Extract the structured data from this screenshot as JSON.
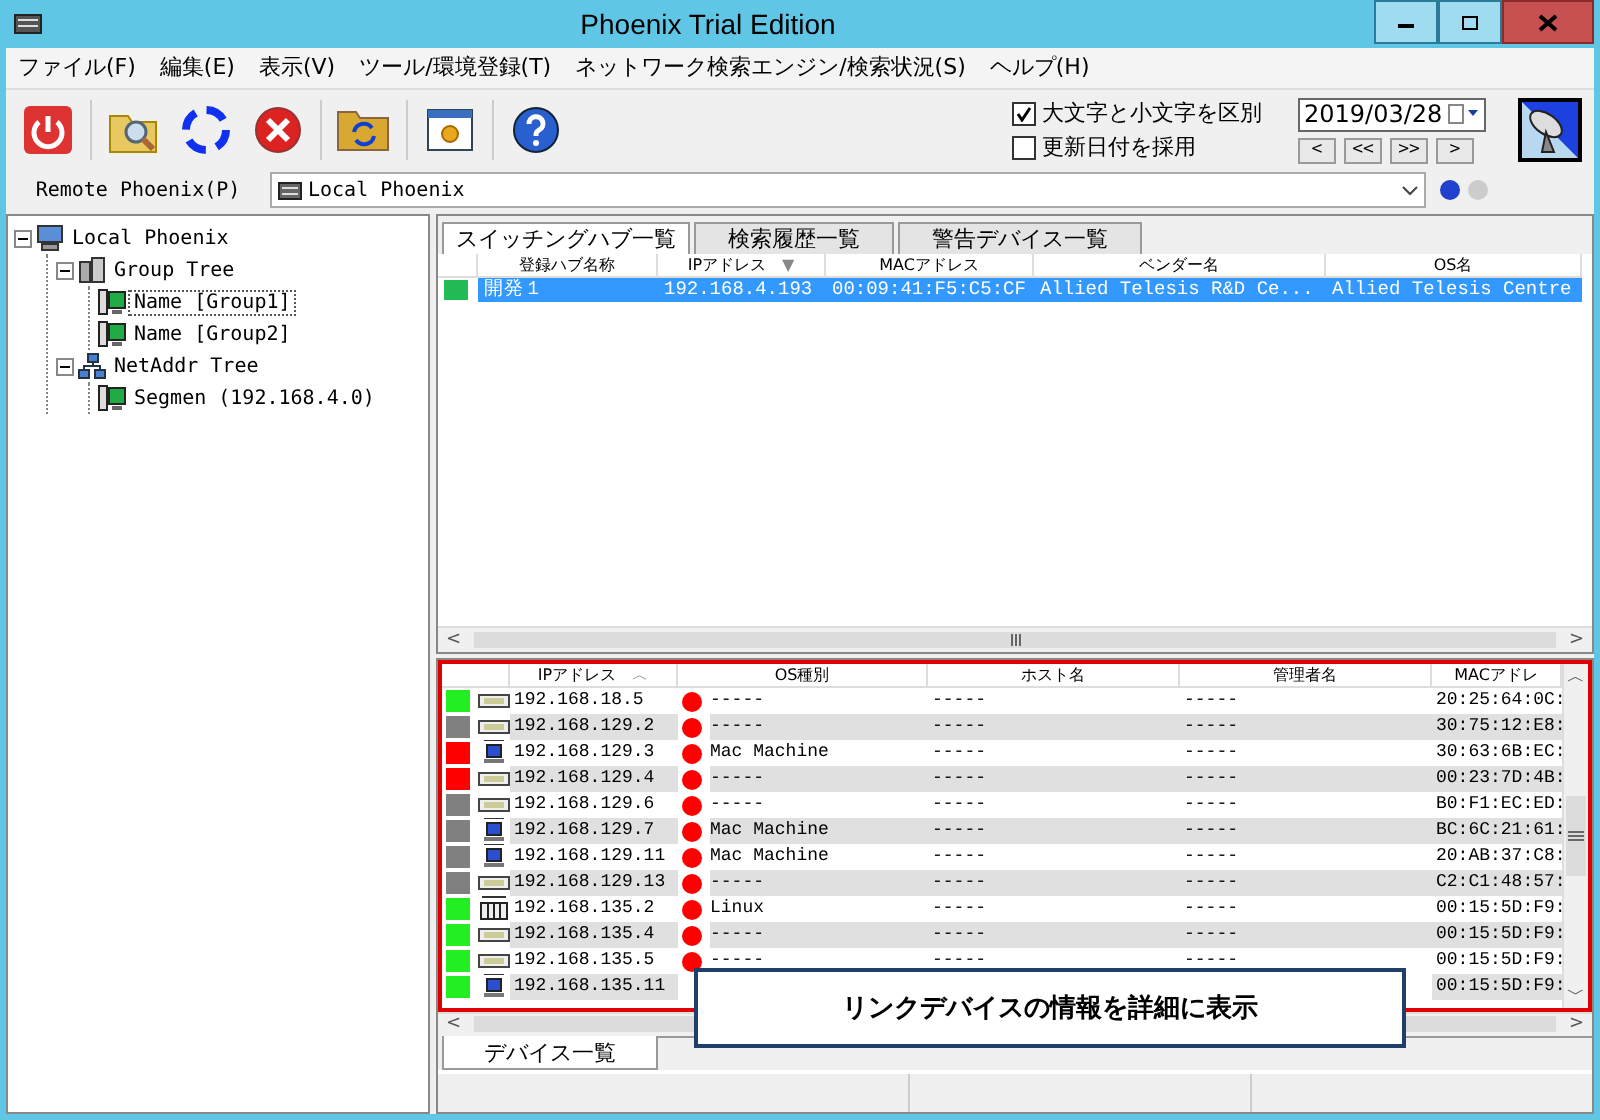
{
  "window": {
    "title": "Phoenix Trial Edition"
  },
  "menu": [
    "ファイル(F)",
    "編集(E)",
    "表示(V)",
    "ツール/環境登録(T)",
    "ネットワーク検索エンジン/検索状況(S)",
    "ヘルプ(H)"
  ],
  "options": [
    {
      "label": "大文字と小文字を区別",
      "checked": true
    },
    {
      "label": "更新日付を採用",
      "checked": false
    }
  ],
  "date_field": {
    "value": "2019/03/28"
  },
  "nav_buttons": [
    "<",
    "<<",
    ">>",
    ">"
  ],
  "remote": {
    "label": "Remote Phoenix(P)",
    "value": "Local Phoenix"
  },
  "tree": [
    {
      "label": "Local Phoenix",
      "kind": "computer",
      "expanded": true,
      "children": [
        {
          "label": "Group Tree",
          "kind": "group",
          "expanded": true,
          "children": [
            {
              "label": "Name [Group1]",
              "kind": "node",
              "selected": true
            },
            {
              "label": "Name [Group2]",
              "kind": "node",
              "selected": false
            }
          ]
        },
        {
          "label": "NetAddr Tree",
          "kind": "network",
          "expanded": true,
          "children": [
            {
              "label": "Segmen (192.168.4.0)",
              "kind": "node",
              "selected": false
            }
          ]
        }
      ]
    }
  ],
  "hub_tabs": [
    {
      "label": "スイッチングハブ一覧",
      "selected": true
    },
    {
      "label": "検索履歴一覧",
      "selected": false
    },
    {
      "label": "警告デバイス一覧",
      "selected": false
    }
  ],
  "hub_table": {
    "columns": [
      {
        "label": "登録ハブ名称"
      },
      {
        "label": "IPアドレス",
        "sort": "▼"
      },
      {
        "label": "MACアドレス"
      },
      {
        "label": "ベンダー名"
      },
      {
        "label": "OS名"
      }
    ],
    "rows": [
      {
        "color": "#22bb55",
        "selected": true,
        "cells": [
          "開発１",
          "192.168.4.193",
          "00:09:41:F5:C5:CF",
          "Allied Telesis R&D Ce...",
          "Allied Telesis Centre"
        ]
      }
    ]
  },
  "hub_scrollbar": {
    "left": "<",
    "right": ">"
  },
  "device_table": {
    "columns": [
      {
        "label": "IPアドレス",
        "sort": "︿"
      },
      {
        "label": "OS種別"
      },
      {
        "label": "ホスト名"
      },
      {
        "label": "管理者名"
      },
      {
        "label": "MACアドレ"
      }
    ],
    "rows": [
      {
        "color": "#22ee22",
        "kind": "nic",
        "ip": "192.168.18.5",
        "os": "-----",
        "host": "-----",
        "admin": "-----",
        "mac": "20:25:64:0C:"
      },
      {
        "color": "#808080",
        "kind": "nic",
        "ip": "192.168.129.2",
        "os": "-----",
        "host": "-----",
        "admin": "-----",
        "mac": "30:75:12:E8:"
      },
      {
        "color": "#ff0000",
        "kind": "mac",
        "ip": "192.168.129.3",
        "os": "Mac Machine",
        "host": "-----",
        "admin": "-----",
        "mac": "30:63:6B:EC:"
      },
      {
        "color": "#ff0000",
        "kind": "nic",
        "ip": "192.168.129.4",
        "os": "-----",
        "host": "-----",
        "admin": "-----",
        "mac": "00:23:7D:4B:"
      },
      {
        "color": "#808080",
        "kind": "nic",
        "ip": "192.168.129.6",
        "os": "-----",
        "host": "-----",
        "admin": "-----",
        "mac": "B0:F1:EC:ED:"
      },
      {
        "color": "#808080",
        "kind": "mac",
        "ip": "192.168.129.7",
        "os": "Mac Machine",
        "host": "-----",
        "admin": "-----",
        "mac": "BC:6C:21:61:"
      },
      {
        "color": "#808080",
        "kind": "mac",
        "ip": "192.168.129.11",
        "os": "Mac Machine",
        "host": "-----",
        "admin": "-----",
        "mac": "20:AB:37:C8:"
      },
      {
        "color": "#808080",
        "kind": "nic",
        "ip": "192.168.129.13",
        "os": "-----",
        "host": "-----",
        "admin": "-----",
        "mac": "C2:C1:48:57:"
      },
      {
        "color": "#22ee22",
        "kind": "linux",
        "ip": "192.168.135.2",
        "os": "Linux",
        "host": "-----",
        "admin": "-----",
        "mac": "00:15:5D:F9:"
      },
      {
        "color": "#22ee22",
        "kind": "nic",
        "ip": "192.168.135.4",
        "os": "-----",
        "host": "-----",
        "admin": "-----",
        "mac": "00:15:5D:F9:"
      },
      {
        "color": "#22ee22",
        "kind": "nic",
        "ip": "192.168.135.5",
        "os": "-----",
        "host": "-----",
        "admin": "-----",
        "mac": "00:15:5D:F9:"
      },
      {
        "color": "#22ee22",
        "kind": "mac",
        "ip": "192.168.135.11",
        "mac": "00:15:5D:F9:"
      }
    ]
  },
  "device_vscrollbar": {
    "up": "︿",
    "down": "﹀"
  },
  "device_scrollbar": {
    "left": "<",
    "right": ">"
  },
  "device_tabs": [
    {
      "label": "デバイス一覧",
      "selected": true
    }
  ],
  "callout": "リンクデバイスの情報を詳細に表示"
}
